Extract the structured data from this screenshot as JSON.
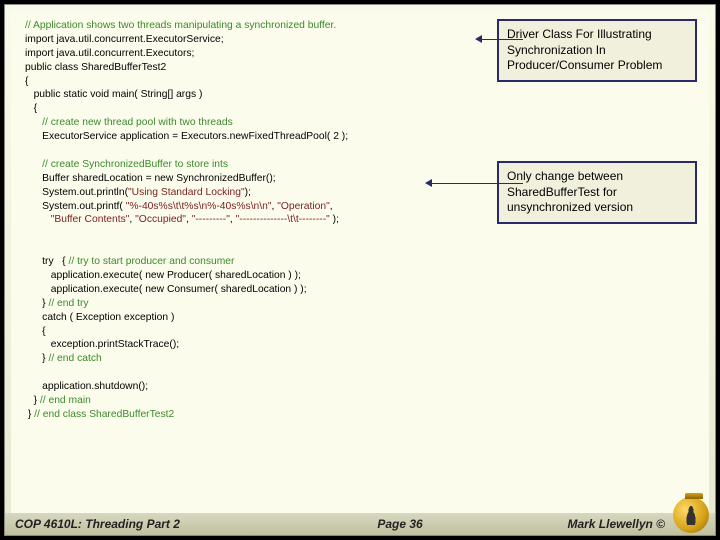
{
  "code": {
    "c1": "// Application shows two threads manipulating a synchronized buffer.",
    "l2": "import java.util.concurrent.ExecutorService;",
    "l3": "import java.util.concurrent.Executors;",
    "l4": "public class SharedBufferTest2",
    "l5": "{",
    "l6": "   public static void main( String[] args )",
    "l7": "   {",
    "c8": "      // create new thread pool with two threads",
    "l9": "      ExecutorService application = Executors.newFixedThreadPool( 2 );",
    "c10": "      // create SynchronizedBuffer to store ints",
    "l11": "      Buffer sharedLocation = new SynchronizedBuffer();",
    "l12a": "      System.out.println(",
    "s12": "\"Using Standard Locking\"",
    "l12b": ");",
    "l13a": "      System.out.printf( ",
    "s13a": "\"%-40s%s\\t\\t%s\\n%-40s%s\\n\\n\"",
    "l13b": ", ",
    "s13b": "\"Operation\"",
    "l13c": ",",
    "l14a": "         ",
    "s14a": "\"Buffer Contents\"",
    "l14b": ", ",
    "s14b": "\"Occupied\"",
    "l14c": ", ",
    "s14c": "\"---------\"",
    "l14d": ", ",
    "s14d": "\"--------------\\t\\t--------\"",
    "l14e": " );",
    "l16a": "      try   { ",
    "c16": "// try to start producer and consumer",
    "l17": "         application.execute( new Producer( sharedLocation ) );",
    "l18": "         application.execute( new Consumer( sharedLocation ) );",
    "l19a": "      } ",
    "c19": "// end try",
    "l20": "      catch ( Exception exception )",
    "l21": "      {",
    "l22": "         exception.printStackTrace();",
    "l23a": "      } ",
    "c23": "// end catch",
    "l25": "      application.shutdown();",
    "l26a": "   } ",
    "c26": "// end main",
    "l27a": " } ",
    "c27": "// end class SharedBufferTest2"
  },
  "box1": "Driver Class For Illustrating Synchronization In Producer/Consumer Problem",
  "box2": "Only change between SharedBufferTest for unsynchronized version",
  "footer": {
    "left": "COP 4610L: Threading Part 2",
    "mid": "Page 36",
    "right": "Mark Llewellyn ©"
  }
}
